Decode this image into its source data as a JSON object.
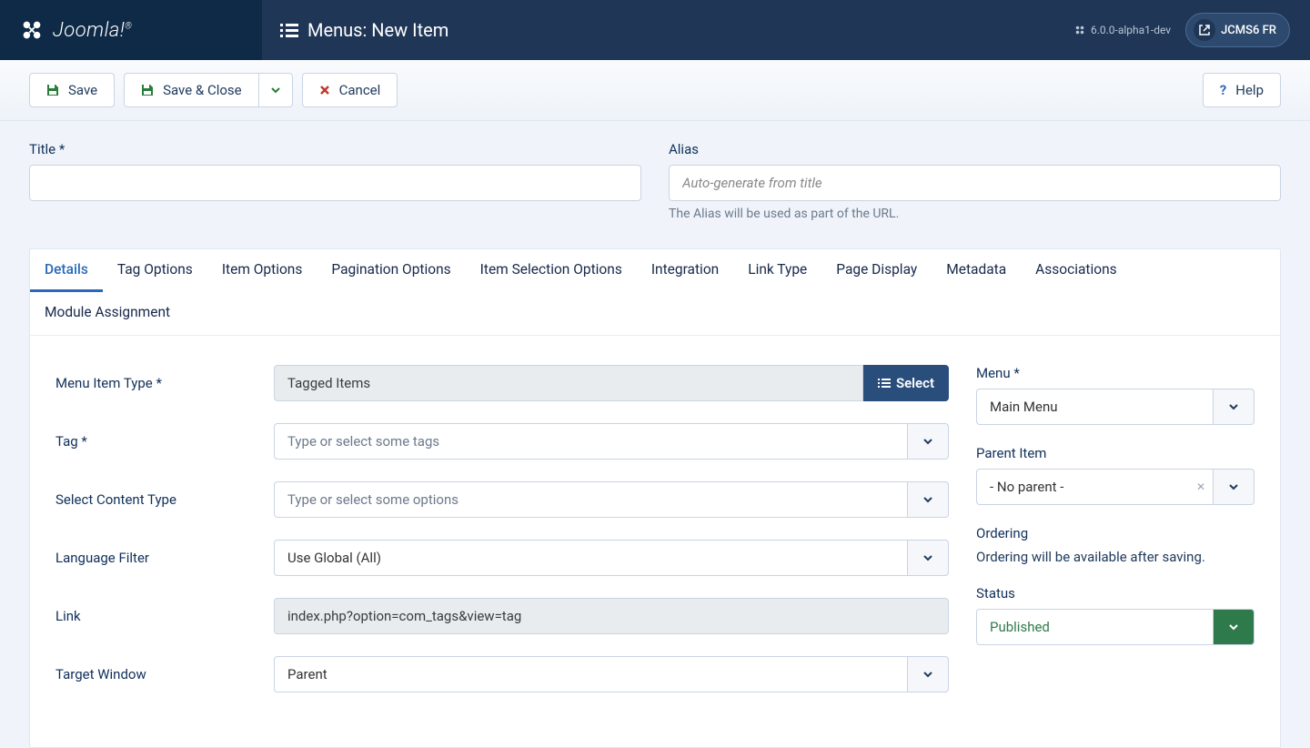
{
  "brand": {
    "name": "Joomla!"
  },
  "header": {
    "title": "Menus: New Item",
    "version": "6.0.0-alpha1-dev",
    "user_badge": "JCMS6 FR"
  },
  "toolbar": {
    "save": "Save",
    "save_close": "Save & Close",
    "cancel": "Cancel",
    "help": "Help"
  },
  "title_section": {
    "title_label": "Title *",
    "alias_label": "Alias",
    "alias_placeholder": "Auto-generate from title",
    "alias_help": "The Alias will be used as part of the URL."
  },
  "tabs": [
    "Details",
    "Tag Options",
    "Item Options",
    "Pagination Options",
    "Item Selection Options",
    "Integration",
    "Link Type",
    "Page Display",
    "Metadata",
    "Associations",
    "Module Assignment"
  ],
  "details": {
    "menu_item_type": {
      "label": "Menu Item Type *",
      "value": "Tagged Items",
      "select_label": "Select"
    },
    "tag": {
      "label": "Tag *",
      "placeholder": "Type or select some tags"
    },
    "content_type": {
      "label": "Select Content Type",
      "placeholder": "Type or select some options"
    },
    "language_filter": {
      "label": "Language Filter",
      "value": "Use Global (All)"
    },
    "link": {
      "label": "Link",
      "value": "index.php?option=com_tags&view=tag"
    },
    "target_window": {
      "label": "Target Window",
      "value": "Parent"
    }
  },
  "side": {
    "menu": {
      "label": "Menu *",
      "value": "Main Menu"
    },
    "parent": {
      "label": "Parent Item",
      "value": "- No parent -"
    },
    "ordering": {
      "label": "Ordering",
      "text": "Ordering will be available after saving."
    },
    "status": {
      "label": "Status",
      "value": "Published"
    }
  }
}
